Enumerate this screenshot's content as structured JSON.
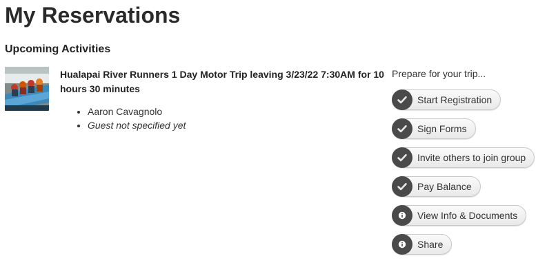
{
  "page_title": "My Reservations",
  "section_title": "Upcoming Activities",
  "activity": {
    "title": "Hualapai River Runners 1 Day Motor Trip leaving 3/23/22 7:30AM for 10 hours 30 minutes",
    "guests": [
      "Aaron Cavagnolo",
      "Guest not specified yet"
    ]
  },
  "prepare": {
    "label": "Prepare for your trip...",
    "actions": [
      {
        "label": "Start Registration",
        "icon": "checkmark-icon"
      },
      {
        "label": "Sign Forms",
        "icon": "checkmark-icon"
      },
      {
        "label": "Invite others to join group",
        "icon": "checkmark-icon"
      },
      {
        "label": "Pay Balance",
        "icon": "checkmark-icon"
      },
      {
        "label": "View Info & Documents",
        "icon": "info-icon"
      },
      {
        "label": "Share",
        "icon": "info-icon"
      }
    ]
  },
  "colors": {
    "icon_bg": "#4a4a4a",
    "button_border": "#c8c8c8",
    "title_text": "#2a2a2a"
  }
}
